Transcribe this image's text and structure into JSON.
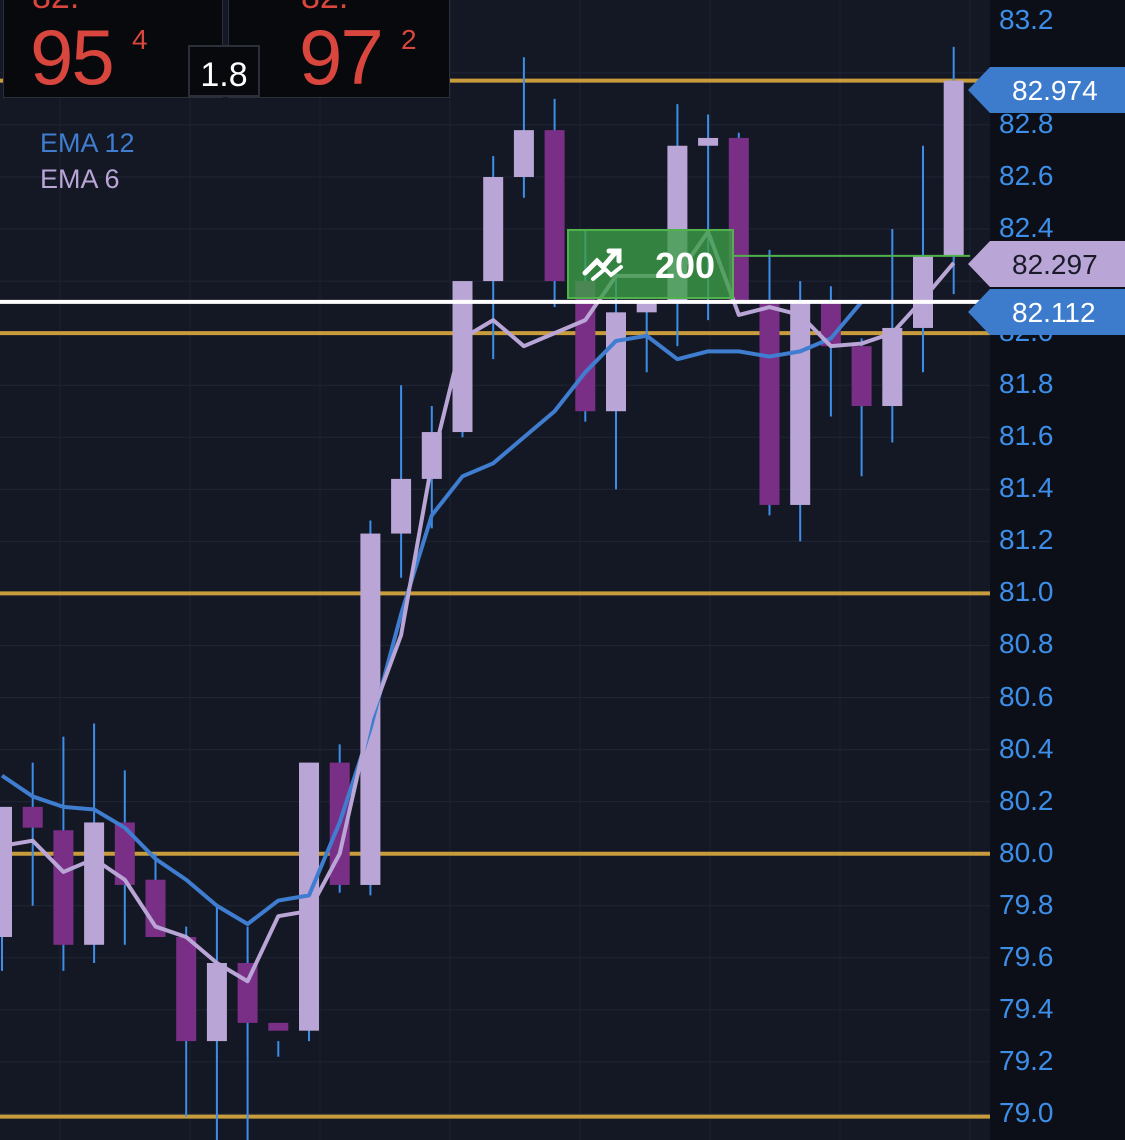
{
  "quote": {
    "bid_prefix": "82.",
    "bid_big": "95",
    "bid_sup": "4",
    "ask_prefix": "82.",
    "ask_big": "97",
    "ask_sup": "2",
    "spread": "1.8"
  },
  "legend": [
    {
      "label": "EMA 12",
      "color": "#3f7dd0"
    },
    {
      "label": "EMA 6",
      "color": "#b9a6d6"
    }
  ],
  "order": {
    "quantity": "200",
    "icon": "trend-arrows-icon"
  },
  "tags": [
    {
      "text": "82.974",
      "color": "#3d7ccc",
      "text_color": "#ffffff"
    },
    {
      "text": "82.297",
      "color": "#b9a6d6",
      "text_color": "#1a1a2a"
    },
    {
      "text": "82.112",
      "color": "#3d7ccc",
      "text_color": "#ffffff"
    }
  ],
  "colors": {
    "background": "#141824",
    "bull": "#b9a6d6",
    "bear": "#7a2f86",
    "wick": "#3d8ee8",
    "level": "#c89b3c",
    "white_line": "#ffffff",
    "order_line": "#4fb24a"
  },
  "chart_data": {
    "type": "candlestick",
    "ylim": [
      78.9,
      83.28
    ],
    "y_ticks": [
      "83.2",
      "82.8",
      "82.6",
      "82.4",
      "82.0",
      "81.8",
      "81.6",
      "81.4",
      "81.2",
      "81.0",
      "80.8",
      "80.6",
      "80.4",
      "80.2",
      "80.0",
      "79.8",
      "79.6",
      "79.4",
      "79.2",
      "79.0"
    ],
    "levels": [
      82.97,
      82.0,
      81.0,
      80.0,
      78.99
    ],
    "white_line": 82.12,
    "order_price": 82.297,
    "candles": [
      {
        "o": 79.68,
        "h": 80.12,
        "l": 79.55,
        "c": 80.18
      },
      {
        "o": 80.18,
        "h": 80.35,
        "l": 79.8,
        "c": 80.1
      },
      {
        "o": 80.09,
        "h": 80.45,
        "l": 79.55,
        "c": 79.65
      },
      {
        "o": 79.65,
        "h": 80.5,
        "l": 79.58,
        "c": 80.12
      },
      {
        "o": 80.12,
        "h": 80.32,
        "l": 79.65,
        "c": 79.88
      },
      {
        "o": 79.9,
        "h": 80.0,
        "l": 79.72,
        "c": 79.68
      },
      {
        "o": 79.68,
        "h": 79.72,
        "l": 78.99,
        "c": 79.28
      },
      {
        "o": 79.28,
        "h": 79.8,
        "l": 78.9,
        "c": 79.58
      },
      {
        "o": 79.58,
        "h": 79.72,
        "l": 78.89,
        "c": 79.35
      },
      {
        "o": 79.35,
        "h": 79.28,
        "l": 79.22,
        "c": 79.32
      },
      {
        "o": 79.32,
        "h": 80.35,
        "l": 79.28,
        "c": 80.35
      },
      {
        "o": 80.35,
        "h": 80.42,
        "l": 79.85,
        "c": 79.88
      },
      {
        "o": 79.88,
        "h": 81.28,
        "l": 79.84,
        "c": 81.23
      },
      {
        "o": 81.23,
        "h": 81.8,
        "l": 81.06,
        "c": 81.44
      },
      {
        "o": 81.44,
        "h": 81.72,
        "l": 81.25,
        "c": 81.62
      },
      {
        "o": 81.62,
        "h": 82.2,
        "l": 81.6,
        "c": 82.2
      },
      {
        "o": 82.2,
        "h": 82.68,
        "l": 81.9,
        "c": 82.6
      },
      {
        "o": 82.6,
        "h": 83.06,
        "l": 82.52,
        "c": 82.78
      },
      {
        "o": 82.78,
        "h": 82.9,
        "l": 82.1,
        "c": 82.2
      },
      {
        "o": 82.2,
        "h": 82.4,
        "l": 81.66,
        "c": 81.7
      },
      {
        "o": 81.7,
        "h": 82.25,
        "l": 81.4,
        "c": 82.08
      },
      {
        "o": 82.08,
        "h": 82.12,
        "l": 81.85,
        "c": 82.12
      },
      {
        "o": 82.12,
        "h": 82.88,
        "l": 81.95,
        "c": 82.72
      },
      {
        "o": 82.72,
        "h": 82.84,
        "l": 82.05,
        "c": 82.75
      },
      {
        "o": 82.75,
        "h": 82.77,
        "l": 82.12,
        "c": 82.12
      },
      {
        "o": 82.12,
        "h": 82.32,
        "l": 81.3,
        "c": 81.34
      },
      {
        "o": 81.34,
        "h": 82.2,
        "l": 81.2,
        "c": 82.12
      },
      {
        "o": 82.12,
        "h": 82.18,
        "l": 81.68,
        "c": 81.95
      },
      {
        "o": 81.95,
        "h": 81.98,
        "l": 81.45,
        "c": 81.72
      },
      {
        "o": 81.72,
        "h": 82.4,
        "l": 81.58,
        "c": 82.02
      },
      {
        "o": 82.02,
        "h": 82.72,
        "l": 81.85,
        "c": 82.3
      },
      {
        "o": 82.3,
        "h": 83.1,
        "l": 82.15,
        "c": 82.97
      }
    ],
    "ema12": [
      80.3,
      80.22,
      80.18,
      80.17,
      80.1,
      79.98,
      79.9,
      79.8,
      79.73,
      79.82,
      79.84,
      80.12,
      80.48,
      80.92,
      81.3,
      81.45,
      81.5,
      81.6,
      81.7,
      81.85,
      81.97,
      81.99,
      81.9,
      81.93,
      81.93,
      81.91,
      81.93,
      81.98,
      82.12
    ],
    "ema6": [
      80.03,
      80.05,
      79.93,
      79.98,
      79.9,
      79.72,
      79.68,
      79.58,
      79.51,
      79.76,
      79.78,
      80.0,
      80.52,
      80.84,
      81.5,
      81.98,
      82.05,
      81.95,
      82.0,
      82.05,
      82.22,
      82.22,
      82.22,
      82.39,
      82.07,
      82.1,
      82.07,
      81.95,
      81.96,
      82.0,
      82.13,
      82.27
    ]
  }
}
